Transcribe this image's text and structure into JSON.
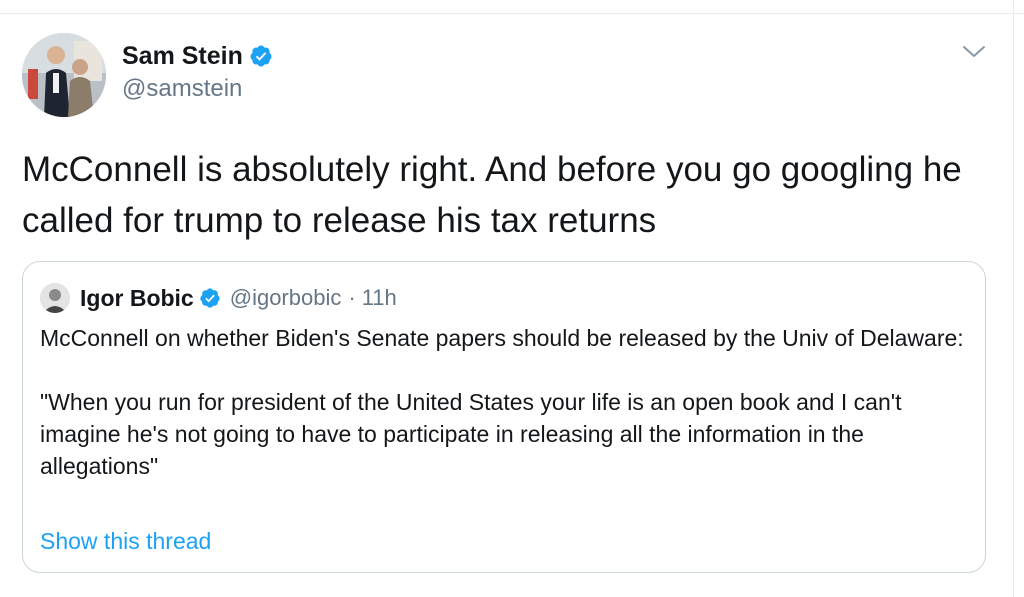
{
  "tweet": {
    "author_name": "Sam Stein",
    "author_handle": "@samstein",
    "text": "McConnell is absolutely right. And before you go googling he called for trump to release his tax returns"
  },
  "quoted_tweet": {
    "author_name": "Igor Bobic",
    "author_handle": "@igorbobic",
    "separator": "·",
    "time": "11h",
    "paragraphs": [
      "McConnell on whether Biden's Senate papers should be released by the Univ of Delaware:",
      "\"When you run for president of the United States your life is an open book and I can't imagine he's not going to have to participate in releasing all the information in the allegations\""
    ],
    "show_thread_label": "Show this thread"
  },
  "icons": {
    "verified": "verified-badge-icon",
    "caret": "chevron-down-icon"
  },
  "colors": {
    "text": "#14171a",
    "secondary_text": "#657786",
    "link": "#1da1f2",
    "border": "#ccd6dd",
    "verified": "#1da1f2"
  }
}
